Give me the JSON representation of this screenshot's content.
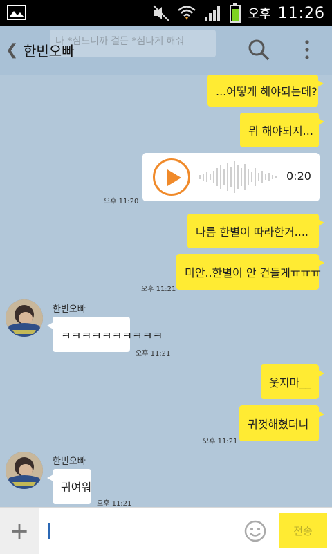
{
  "status_bar": {
    "ampm": "오후",
    "time": "11:26"
  },
  "header": {
    "title": "한빈오빠",
    "pinned_notice": "나 *심드니까 걸든 *심나게 해줘"
  },
  "messages": {
    "m1": "...어떻게 해야되는데?",
    "m2": "뭐 해야되지...",
    "voice_duration": "0:20",
    "t1": "오후 11:20",
    "m3": "나름 한별이 따라한거....",
    "m4": "미안..한별이 안 건들게ㅠㅠㅠ",
    "t2": "오후 11:21",
    "sender1": "한빈오빠",
    "m5": "ㅋㅋㅋㅋㅋㅋㅋㅋㅋㅋ",
    "t3": "오후 11:21",
    "m6": "웃지마__",
    "m7": "귀껏해혔더니",
    "t4": "오후 11:21",
    "sender2": "한빈오빠",
    "m8": "귀여워",
    "t5": "오후 11:21"
  },
  "input_bar": {
    "placeholder": "",
    "send_label": "전송"
  },
  "colors": {
    "background": "#b2c7d9",
    "my_bubble": "#ffeb33",
    "other_bubble": "#ffffff",
    "accent": "#f08a2a"
  },
  "icons": [
    "back-icon",
    "search-icon",
    "more-icon",
    "play-icon",
    "plus-icon",
    "emoji-icon"
  ]
}
